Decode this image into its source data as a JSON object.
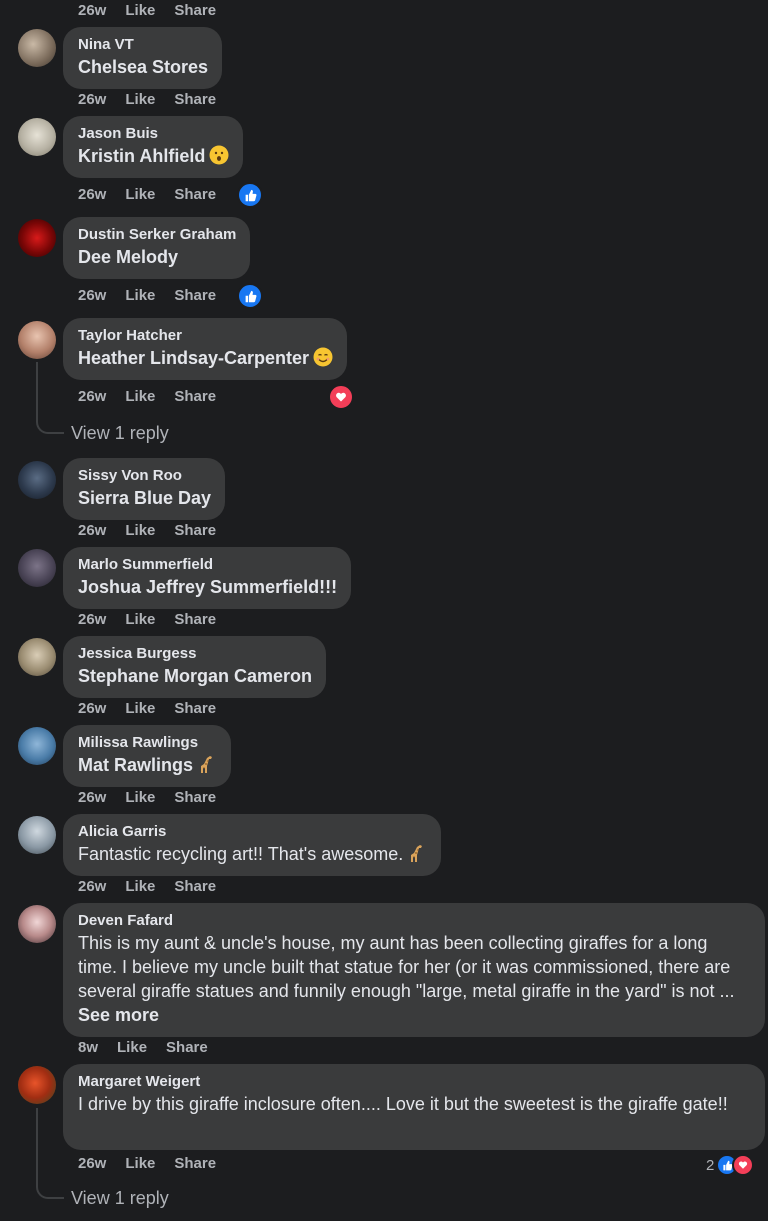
{
  "top_actions": {
    "time": "26w",
    "like": "Like",
    "share": "Share"
  },
  "comments": [
    {
      "author": "Nina VT",
      "text": "Chelsea Stores",
      "time": "26w",
      "like": "Like",
      "share": "Share"
    },
    {
      "author": "Jason Buis",
      "text": "Kristin Ahlfield",
      "time": "26w",
      "like": "Like",
      "share": "Share",
      "emoji": "hushed-face"
    },
    {
      "author": "Dustin Serker Graham",
      "text": "Dee Melody",
      "time": "26w",
      "like": "Like",
      "share": "Share"
    },
    {
      "author": "Taylor Hatcher",
      "text": "Heather Lindsay-Carpenter",
      "time": "26w",
      "like": "Like",
      "share": "Share",
      "emoji": "smiling-face",
      "view_reply": "View 1 reply"
    },
    {
      "author": "Sissy Von Roo",
      "text": "Sierra Blue Day",
      "time": "26w",
      "like": "Like",
      "share": "Share"
    },
    {
      "author": "Marlo Summerfield",
      "text": "Joshua Jeffrey Summerfield!!!",
      "time": "26w",
      "like": "Like",
      "share": "Share"
    },
    {
      "author": "Jessica Burgess",
      "text": "Stephane Morgan Cameron",
      "time": "26w",
      "like": "Like",
      "share": "Share"
    },
    {
      "author": "Milissa Rawlings",
      "text": "Mat Rawlings",
      "time": "26w",
      "like": "Like",
      "share": "Share",
      "emoji": "giraffe"
    },
    {
      "author": "Alicia Garris",
      "text": "Fantastic recycling art!! That's awesome.",
      "time": "26w",
      "like": "Like",
      "share": "Share",
      "emoji": "giraffe"
    },
    {
      "author": "Deven Fafard",
      "text": "This is my aunt & uncle's house, my aunt has been collecting giraffes for a long time. I believe my uncle built that statue for her (or it was commissioned, there are several giraffe statues and funnily enough \"large, metal giraffe in the yard\" is not ...",
      "see_more": "See more",
      "time": "8w",
      "like": "Like",
      "share": "Share"
    },
    {
      "author": "Margaret Weigert",
      "text": "I drive by this giraffe inclosure often.... Love it but the sweetest is the giraffe gate!!",
      "time": "26w",
      "like": "Like",
      "share": "Share",
      "reaction_count": "2",
      "view_reply": "View 1 reply"
    }
  ],
  "colors": {
    "background": "#1c1d1f",
    "bubble": "#3a3b3c",
    "like_blue": "#1877f2",
    "love_red": "#f33e58",
    "muted": "#b0b3b8"
  }
}
